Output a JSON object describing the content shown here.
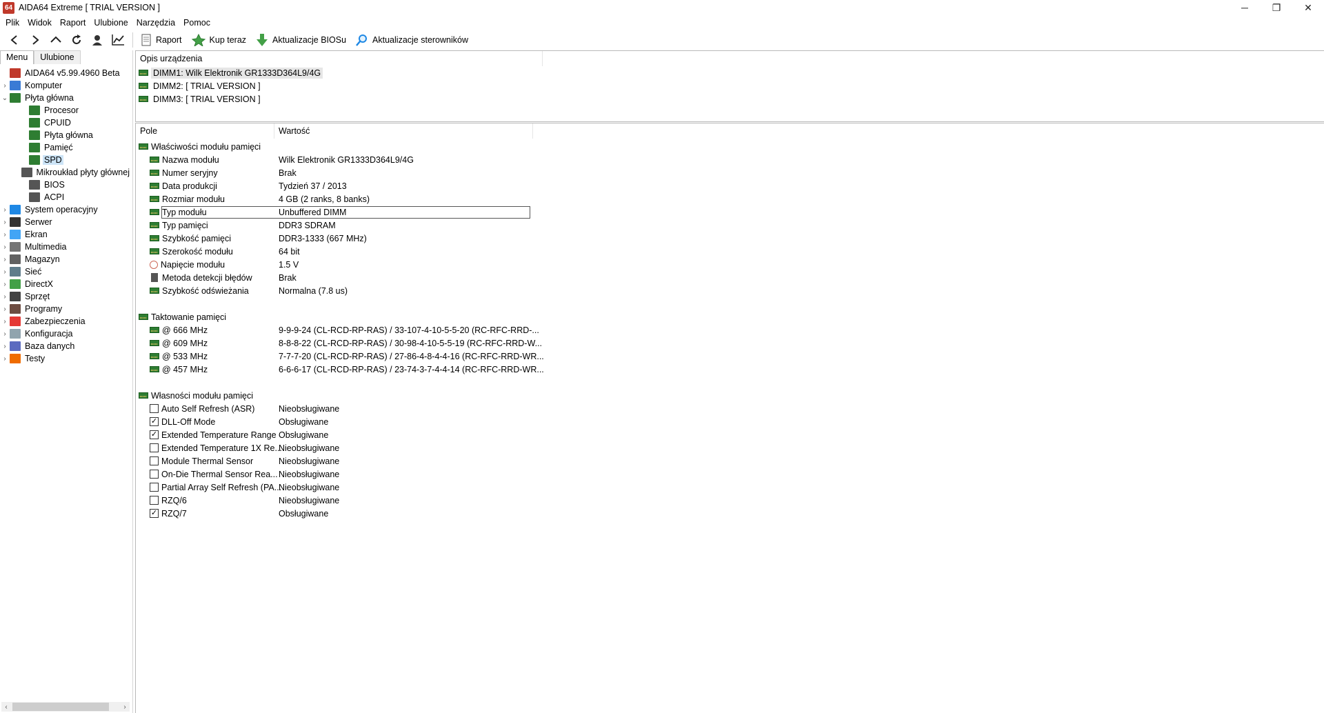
{
  "window": {
    "title": "AIDA64 Extreme  [ TRIAL VERSION ]",
    "logo_text": "64",
    "controls": {
      "minimize": "─",
      "maximize": "❐",
      "close": "✕"
    }
  },
  "menubar": [
    "Plik",
    "Widok",
    "Raport",
    "Ulubione",
    "Narzędzia",
    "Pomoc"
  ],
  "toolbar": {
    "nav": {
      "back": "‹",
      "forward": "›",
      "up": "⌃",
      "refresh": "↻",
      "user": "●",
      "chart": "📈"
    },
    "buttons": [
      {
        "label": "Raport"
      },
      {
        "label": "Kup teraz"
      },
      {
        "label": "Aktualizacje BIOSu"
      },
      {
        "label": "Aktualizacje sterowników"
      }
    ]
  },
  "left_tabs": [
    "Menu",
    "Ulubione"
  ],
  "tree": [
    {
      "label": "AIDA64 v5.99.4960 Beta",
      "level": 0,
      "exp": "",
      "icon": "#c0392b"
    },
    {
      "label": "Komputer",
      "level": 0,
      "exp": "›",
      "icon": "#3a7bd5"
    },
    {
      "label": "Płyta główna",
      "level": 0,
      "exp": "⌄",
      "icon": "#2e7d32"
    },
    {
      "label": "Procesor",
      "level": 1,
      "exp": "",
      "icon": "#2e7d32"
    },
    {
      "label": "CPUID",
      "level": 1,
      "exp": "",
      "icon": "#2e7d32"
    },
    {
      "label": "Płyta główna",
      "level": 1,
      "exp": "",
      "icon": "#2e7d32"
    },
    {
      "label": "Pamięć",
      "level": 1,
      "exp": "",
      "icon": "#2e7d32"
    },
    {
      "label": "SPD",
      "level": 1,
      "exp": "",
      "icon": "#2e7d32",
      "selected": true
    },
    {
      "label": "Mikroukład płyty głównej",
      "level": 1,
      "exp": "",
      "icon": "#555555"
    },
    {
      "label": "BIOS",
      "level": 1,
      "exp": "",
      "icon": "#555555"
    },
    {
      "label": "ACPI",
      "level": 1,
      "exp": "",
      "icon": "#555555"
    },
    {
      "label": "System operacyjny",
      "level": 0,
      "exp": "›",
      "icon": "#1e88e5"
    },
    {
      "label": "Serwer",
      "level": 0,
      "exp": "›",
      "icon": "#333333"
    },
    {
      "label": "Ekran",
      "level": 0,
      "exp": "›",
      "icon": "#42a5f5"
    },
    {
      "label": "Multimedia",
      "level": 0,
      "exp": "›",
      "icon": "#757575"
    },
    {
      "label": "Magazyn",
      "level": 0,
      "exp": "›",
      "icon": "#616161"
    },
    {
      "label": "Sieć",
      "level": 0,
      "exp": "›",
      "icon": "#607d8b"
    },
    {
      "label": "DirectX",
      "level": 0,
      "exp": "›",
      "icon": "#43a047"
    },
    {
      "label": "Sprzęt",
      "level": 0,
      "exp": "›",
      "icon": "#424242"
    },
    {
      "label": "Programy",
      "level": 0,
      "exp": "›",
      "icon": "#6d4c41"
    },
    {
      "label": "Zabezpieczenia",
      "level": 0,
      "exp": "›",
      "icon": "#e53935"
    },
    {
      "label": "Konfiguracja",
      "level": 0,
      "exp": "›",
      "icon": "#90a4ae"
    },
    {
      "label": "Baza danych",
      "level": 0,
      "exp": "›",
      "icon": "#5c6bc0"
    },
    {
      "label": "Testy",
      "level": 0,
      "exp": "›",
      "icon": "#ef6c00"
    }
  ],
  "device_panel": {
    "header": "Opis urządzenia",
    "items": [
      {
        "label": "DIMM1: Wilk Elektronik GR1333D364L9/4G",
        "selected": true
      },
      {
        "label": "DIMM2: [ TRIAL VERSION ]"
      },
      {
        "label": "DIMM3: [ TRIAL VERSION ]"
      }
    ]
  },
  "details": {
    "headers": {
      "field": "Pole",
      "value": "Wartość"
    },
    "rows": [
      {
        "type": "group",
        "icon": "ram",
        "field": "Właściwości modułu pamięci",
        "value": ""
      },
      {
        "type": "item",
        "icon": "ram",
        "field": "Nazwa modułu",
        "value": "Wilk Elektronik GR1333D364L9/4G"
      },
      {
        "type": "item",
        "icon": "ram",
        "field": "Numer seryjny",
        "value": "Brak"
      },
      {
        "type": "item",
        "icon": "ram",
        "field": "Data produkcji",
        "value": "Tydzień 37 / 2013"
      },
      {
        "type": "item",
        "icon": "ram",
        "field": "Rozmiar modułu",
        "value": "4 GB (2 ranks, 8 banks)"
      },
      {
        "type": "item",
        "icon": "ram",
        "field": "Typ modułu",
        "value": "Unbuffered DIMM",
        "focus": true
      },
      {
        "type": "item",
        "icon": "ram",
        "field": "Typ pamięci",
        "value": "DDR3 SDRAM"
      },
      {
        "type": "item",
        "icon": "ram",
        "field": "Szybkość pamięci",
        "value": "DDR3-1333 (667 MHz)"
      },
      {
        "type": "item",
        "icon": "ram",
        "field": "Szerokość modułu",
        "value": "64 bit"
      },
      {
        "type": "item",
        "icon": "volt",
        "field": "Napięcie modułu",
        "value": "1.5 V"
      },
      {
        "type": "item",
        "icon": "device",
        "field": "Metoda detekcji błędów",
        "value": "Brak"
      },
      {
        "type": "item",
        "icon": "ram",
        "field": "Szybkość odświeżania",
        "value": "Normalna (7.8 us)"
      },
      {
        "type": "spacer"
      },
      {
        "type": "group",
        "icon": "ram",
        "field": "Taktowanie pamięci",
        "value": ""
      },
      {
        "type": "item",
        "icon": "ram",
        "field": "@ 666 MHz",
        "value": "9-9-9-24  (CL-RCD-RP-RAS) / 33-107-4-10-5-5-20  (RC-RFC-RRD-..."
      },
      {
        "type": "item",
        "icon": "ram",
        "field": "@ 609 MHz",
        "value": "8-8-8-22  (CL-RCD-RP-RAS) / 30-98-4-10-5-5-19  (RC-RFC-RRD-W..."
      },
      {
        "type": "item",
        "icon": "ram",
        "field": "@ 533 MHz",
        "value": "7-7-7-20  (CL-RCD-RP-RAS) / 27-86-4-8-4-4-16  (RC-RFC-RRD-WR..."
      },
      {
        "type": "item",
        "icon": "ram",
        "field": "@ 457 MHz",
        "value": "6-6-6-17  (CL-RCD-RP-RAS) / 23-74-3-7-4-4-14  (RC-RFC-RRD-WR..."
      },
      {
        "type": "spacer"
      },
      {
        "type": "group",
        "icon": "ram",
        "field": "Własności modułu pamięci",
        "value": ""
      },
      {
        "type": "item",
        "icon": "cb",
        "checked": false,
        "field": "Auto Self Refresh (ASR)",
        "value": "Nieobsługiwane"
      },
      {
        "type": "item",
        "icon": "cb",
        "checked": true,
        "field": "DLL-Off Mode",
        "value": "Obsługiwane"
      },
      {
        "type": "item",
        "icon": "cb",
        "checked": true,
        "field": "Extended Temperature Range",
        "value": "Obsługiwane"
      },
      {
        "type": "item",
        "icon": "cb",
        "checked": false,
        "field": "Extended Temperature 1X Re...",
        "value": "Nieobsługiwane"
      },
      {
        "type": "item",
        "icon": "cb",
        "checked": false,
        "field": "Module Thermal Sensor",
        "value": "Nieobsługiwane"
      },
      {
        "type": "item",
        "icon": "cb",
        "checked": false,
        "field": "On-Die Thermal Sensor Rea...",
        "value": "Nieobsługiwane"
      },
      {
        "type": "item",
        "icon": "cb",
        "checked": false,
        "field": "Partial Array Self Refresh (PA...",
        "value": "Nieobsługiwane"
      },
      {
        "type": "item",
        "icon": "cb",
        "checked": false,
        "field": "RZQ/6",
        "value": "Nieobsługiwane"
      },
      {
        "type": "item",
        "icon": "cb",
        "checked": true,
        "field": "RZQ/7",
        "value": "Obsługiwane"
      }
    ]
  },
  "scrollbar": {
    "left": "‹",
    "right": "›"
  },
  "check_glyph": "✓"
}
